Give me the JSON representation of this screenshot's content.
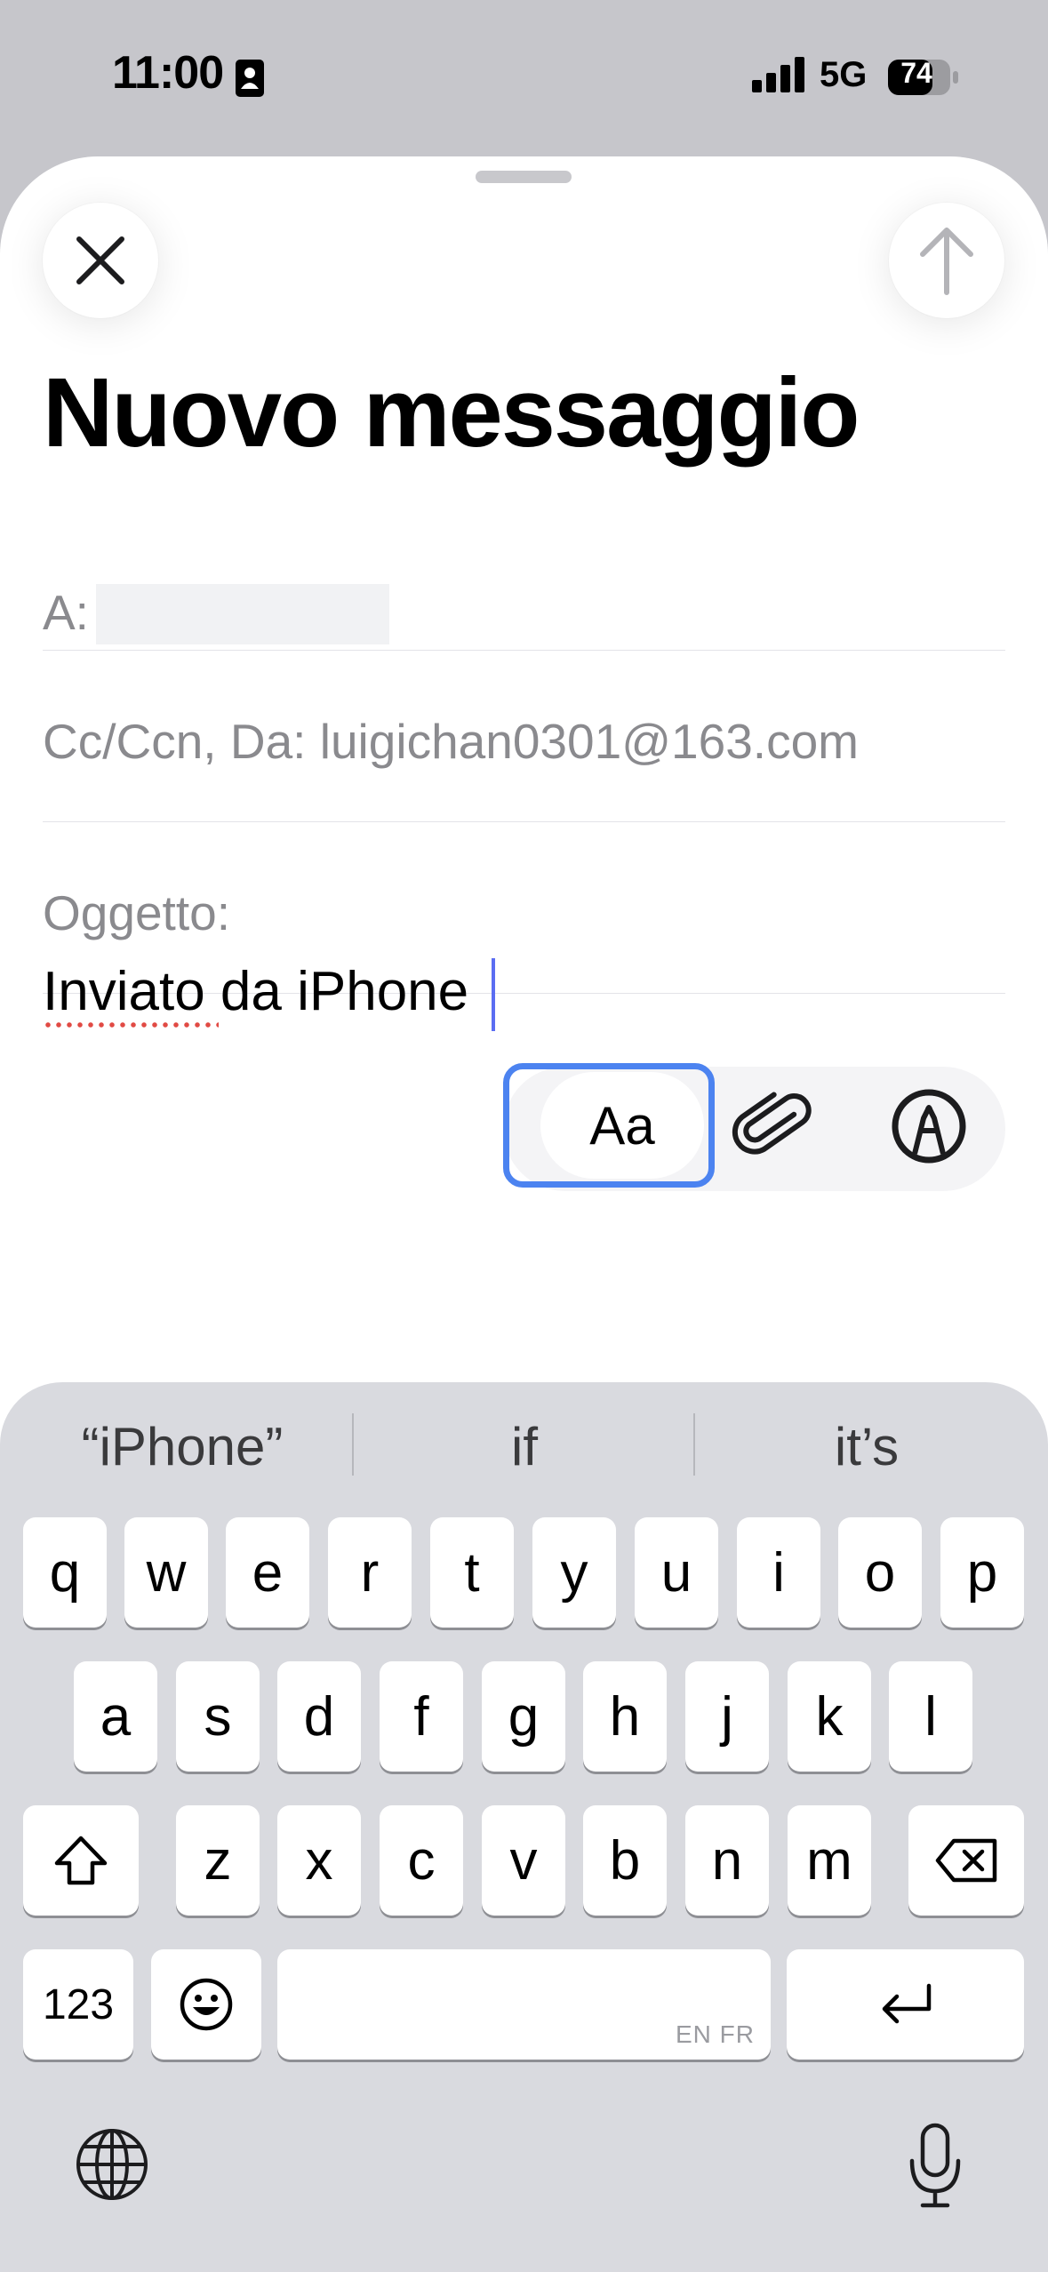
{
  "status_bar": {
    "time": "11:00",
    "network": "5G",
    "battery": "74"
  },
  "compose": {
    "title": "Nuovo messaggio",
    "to_label": "A:",
    "cc_label": "Cc/Ccn, Da: luigichan0301@163.com",
    "subject_label": "Oggetto:",
    "body_text": "Inviato da iPhone"
  },
  "format_toolbar": {
    "aa_label": "Aa"
  },
  "keyboard": {
    "suggestions": [
      "“iPhone”",
      "if",
      "it’s"
    ],
    "row1": [
      "q",
      "w",
      "e",
      "r",
      "t",
      "y",
      "u",
      "i",
      "o",
      "p"
    ],
    "row2": [
      "a",
      "s",
      "d",
      "f",
      "g",
      "h",
      "j",
      "k",
      "l"
    ],
    "row3": [
      "z",
      "x",
      "c",
      "v",
      "b",
      "n",
      "m"
    ],
    "numbers_label": "123",
    "space_hint": "EN FR"
  }
}
